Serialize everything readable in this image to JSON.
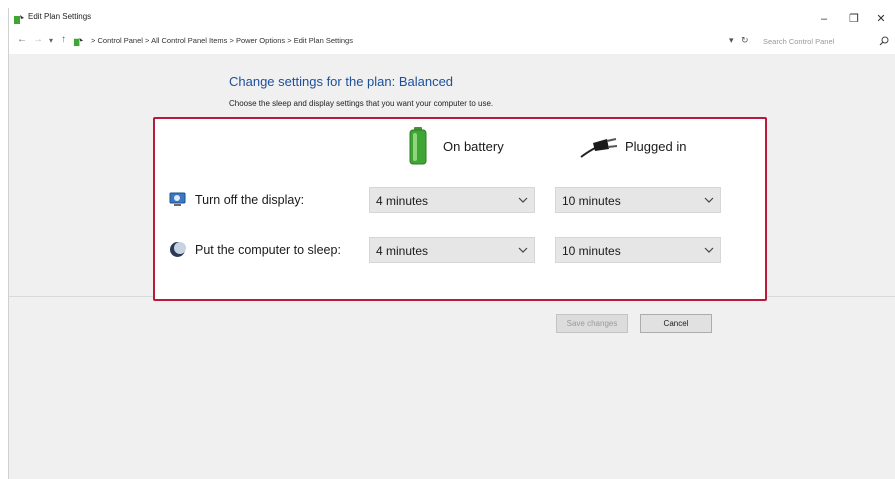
{
  "window": {
    "title": "Edit Plan Settings"
  },
  "window_controls": {
    "minimize": "–",
    "maximize": "❐",
    "close": "✕"
  },
  "nav": {
    "back": "←",
    "forward": "→",
    "recent": "▾",
    "up": "↑"
  },
  "breadcrumb": {
    "separator": ">",
    "items": [
      "Control Panel",
      "All Control Panel Items",
      "Power Options",
      "Edit Plan Settings"
    ]
  },
  "address": {
    "dropdown": "▾",
    "refresh": "↻"
  },
  "search": {
    "placeholder": "Search Control Panel"
  },
  "page": {
    "title": "Change settings for the plan: Balanced",
    "subtitle": "Choose the sleep and display settings that you want your computer to use."
  },
  "columns": {
    "battery": "On battery",
    "plugged": "Plugged in"
  },
  "settings": [
    {
      "label": "Turn off the display:",
      "battery": "4 minutes",
      "plugged": "10 minutes"
    },
    {
      "label": "Put the computer to sleep:",
      "battery": "4 minutes",
      "plugged": "10 minutes"
    }
  ],
  "buttons": {
    "save": "Save changes",
    "cancel": "Cancel"
  },
  "icons": {
    "app": "power-plan-icon",
    "battery": "battery-icon",
    "plug": "plug-icon",
    "display": "monitor-icon",
    "sleep": "moon-icon",
    "search": "search-icon"
  },
  "colors": {
    "highlight_border": "#b81a3c",
    "heading": "#1d4f9c",
    "battery_green": "#3fa535"
  }
}
